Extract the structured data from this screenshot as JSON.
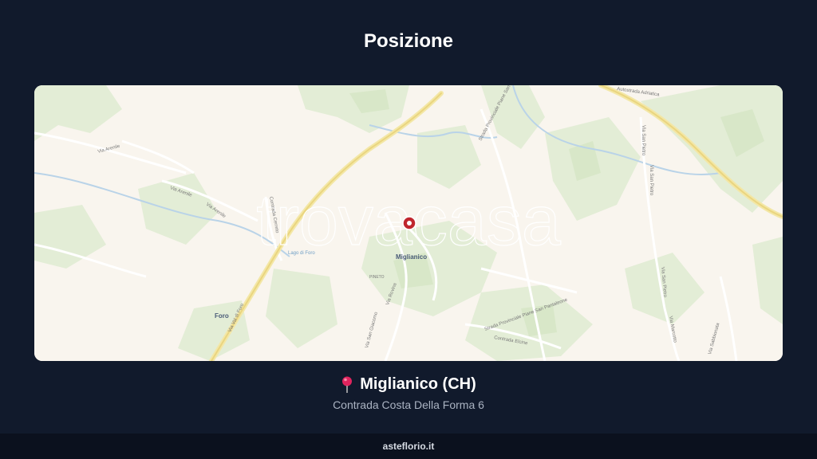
{
  "header": {
    "title": "Posizione"
  },
  "map": {
    "watermark": "trovacasa",
    "marker_color": "#c0262d",
    "labels": {
      "town": "Miglianico",
      "foro": "Foro",
      "pineto": "PINETO",
      "via_arenile_1": "Via Arenile",
      "via_arenile_2": "Via Arenile",
      "via_arenile_3": "Via Arenile",
      "via_val_di_foro": "Via Val di Foro",
      "via_rovina": "Via Rovina",
      "via_san_giacomo": "Via San Giacomo",
      "contrada_elcine": "Contrada Elcine",
      "strada_prov_1": "Strada Provinciale Piane San Pantaleone",
      "strada_prov_2": "Strada Provinciale Piane San Pantaleone",
      "via_san_pietro_1": "Via San Pietro",
      "via_san_pietro_2": "Via San Pietro",
      "via_san_pietro_3": "Via San Pietro",
      "via_marcotto": "Via Marcotto",
      "via_sabbionata": "Via Sabbionata",
      "autostrada": "Autostrada Adriatica",
      "contrada_cerreto": "Contrada Cerreto",
      "lago": "Lago di Foro"
    }
  },
  "location": {
    "name": "Miglianico (CH)",
    "address": "Contrada Costa Della Forma 6",
    "pin_color": "#e0245e"
  },
  "footer": {
    "brand": "asteflorio.it"
  }
}
